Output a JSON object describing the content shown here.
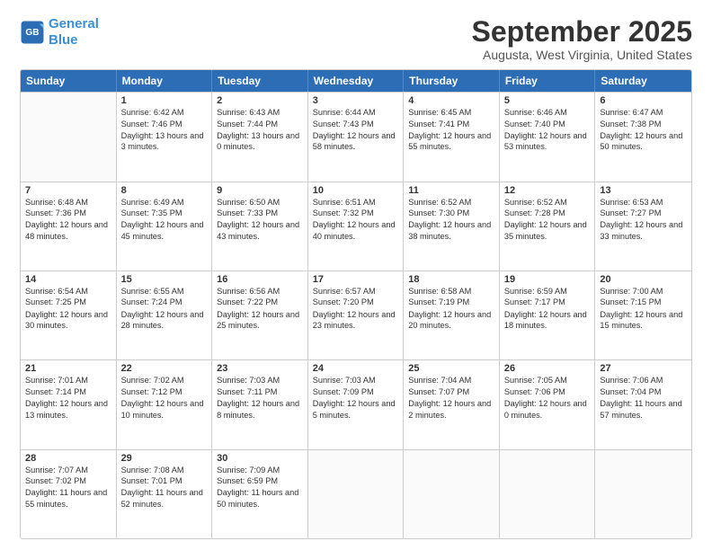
{
  "header": {
    "logo_line1": "General",
    "logo_line2": "Blue",
    "month": "September 2025",
    "location": "Augusta, West Virginia, United States"
  },
  "weekdays": [
    "Sunday",
    "Monday",
    "Tuesday",
    "Wednesday",
    "Thursday",
    "Friday",
    "Saturday"
  ],
  "rows": [
    [
      {
        "day": "",
        "sunrise": "",
        "sunset": "",
        "daylight": ""
      },
      {
        "day": "1",
        "sunrise": "Sunrise: 6:42 AM",
        "sunset": "Sunset: 7:46 PM",
        "daylight": "Daylight: 13 hours and 3 minutes."
      },
      {
        "day": "2",
        "sunrise": "Sunrise: 6:43 AM",
        "sunset": "Sunset: 7:44 PM",
        "daylight": "Daylight: 13 hours and 0 minutes."
      },
      {
        "day": "3",
        "sunrise": "Sunrise: 6:44 AM",
        "sunset": "Sunset: 7:43 PM",
        "daylight": "Daylight: 12 hours and 58 minutes."
      },
      {
        "day": "4",
        "sunrise": "Sunrise: 6:45 AM",
        "sunset": "Sunset: 7:41 PM",
        "daylight": "Daylight: 12 hours and 55 minutes."
      },
      {
        "day": "5",
        "sunrise": "Sunrise: 6:46 AM",
        "sunset": "Sunset: 7:40 PM",
        "daylight": "Daylight: 12 hours and 53 minutes."
      },
      {
        "day": "6",
        "sunrise": "Sunrise: 6:47 AM",
        "sunset": "Sunset: 7:38 PM",
        "daylight": "Daylight: 12 hours and 50 minutes."
      }
    ],
    [
      {
        "day": "7",
        "sunrise": "Sunrise: 6:48 AM",
        "sunset": "Sunset: 7:36 PM",
        "daylight": "Daylight: 12 hours and 48 minutes."
      },
      {
        "day": "8",
        "sunrise": "Sunrise: 6:49 AM",
        "sunset": "Sunset: 7:35 PM",
        "daylight": "Daylight: 12 hours and 45 minutes."
      },
      {
        "day": "9",
        "sunrise": "Sunrise: 6:50 AM",
        "sunset": "Sunset: 7:33 PM",
        "daylight": "Daylight: 12 hours and 43 minutes."
      },
      {
        "day": "10",
        "sunrise": "Sunrise: 6:51 AM",
        "sunset": "Sunset: 7:32 PM",
        "daylight": "Daylight: 12 hours and 40 minutes."
      },
      {
        "day": "11",
        "sunrise": "Sunrise: 6:52 AM",
        "sunset": "Sunset: 7:30 PM",
        "daylight": "Daylight: 12 hours and 38 minutes."
      },
      {
        "day": "12",
        "sunrise": "Sunrise: 6:52 AM",
        "sunset": "Sunset: 7:28 PM",
        "daylight": "Daylight: 12 hours and 35 minutes."
      },
      {
        "day": "13",
        "sunrise": "Sunrise: 6:53 AM",
        "sunset": "Sunset: 7:27 PM",
        "daylight": "Daylight: 12 hours and 33 minutes."
      }
    ],
    [
      {
        "day": "14",
        "sunrise": "Sunrise: 6:54 AM",
        "sunset": "Sunset: 7:25 PM",
        "daylight": "Daylight: 12 hours and 30 minutes."
      },
      {
        "day": "15",
        "sunrise": "Sunrise: 6:55 AM",
        "sunset": "Sunset: 7:24 PM",
        "daylight": "Daylight: 12 hours and 28 minutes."
      },
      {
        "day": "16",
        "sunrise": "Sunrise: 6:56 AM",
        "sunset": "Sunset: 7:22 PM",
        "daylight": "Daylight: 12 hours and 25 minutes."
      },
      {
        "day": "17",
        "sunrise": "Sunrise: 6:57 AM",
        "sunset": "Sunset: 7:20 PM",
        "daylight": "Daylight: 12 hours and 23 minutes."
      },
      {
        "day": "18",
        "sunrise": "Sunrise: 6:58 AM",
        "sunset": "Sunset: 7:19 PM",
        "daylight": "Daylight: 12 hours and 20 minutes."
      },
      {
        "day": "19",
        "sunrise": "Sunrise: 6:59 AM",
        "sunset": "Sunset: 7:17 PM",
        "daylight": "Daylight: 12 hours and 18 minutes."
      },
      {
        "day": "20",
        "sunrise": "Sunrise: 7:00 AM",
        "sunset": "Sunset: 7:15 PM",
        "daylight": "Daylight: 12 hours and 15 minutes."
      }
    ],
    [
      {
        "day": "21",
        "sunrise": "Sunrise: 7:01 AM",
        "sunset": "Sunset: 7:14 PM",
        "daylight": "Daylight: 12 hours and 13 minutes."
      },
      {
        "day": "22",
        "sunrise": "Sunrise: 7:02 AM",
        "sunset": "Sunset: 7:12 PM",
        "daylight": "Daylight: 12 hours and 10 minutes."
      },
      {
        "day": "23",
        "sunrise": "Sunrise: 7:03 AM",
        "sunset": "Sunset: 7:11 PM",
        "daylight": "Daylight: 12 hours and 8 minutes."
      },
      {
        "day": "24",
        "sunrise": "Sunrise: 7:03 AM",
        "sunset": "Sunset: 7:09 PM",
        "daylight": "Daylight: 12 hours and 5 minutes."
      },
      {
        "day": "25",
        "sunrise": "Sunrise: 7:04 AM",
        "sunset": "Sunset: 7:07 PM",
        "daylight": "Daylight: 12 hours and 2 minutes."
      },
      {
        "day": "26",
        "sunrise": "Sunrise: 7:05 AM",
        "sunset": "Sunset: 7:06 PM",
        "daylight": "Daylight: 12 hours and 0 minutes."
      },
      {
        "day": "27",
        "sunrise": "Sunrise: 7:06 AM",
        "sunset": "Sunset: 7:04 PM",
        "daylight": "Daylight: 11 hours and 57 minutes."
      }
    ],
    [
      {
        "day": "28",
        "sunrise": "Sunrise: 7:07 AM",
        "sunset": "Sunset: 7:02 PM",
        "daylight": "Daylight: 11 hours and 55 minutes."
      },
      {
        "day": "29",
        "sunrise": "Sunrise: 7:08 AM",
        "sunset": "Sunset: 7:01 PM",
        "daylight": "Daylight: 11 hours and 52 minutes."
      },
      {
        "day": "30",
        "sunrise": "Sunrise: 7:09 AM",
        "sunset": "Sunset: 6:59 PM",
        "daylight": "Daylight: 11 hours and 50 minutes."
      },
      {
        "day": "",
        "sunrise": "",
        "sunset": "",
        "daylight": ""
      },
      {
        "day": "",
        "sunrise": "",
        "sunset": "",
        "daylight": ""
      },
      {
        "day": "",
        "sunrise": "",
        "sunset": "",
        "daylight": ""
      },
      {
        "day": "",
        "sunrise": "",
        "sunset": "",
        "daylight": ""
      }
    ]
  ]
}
